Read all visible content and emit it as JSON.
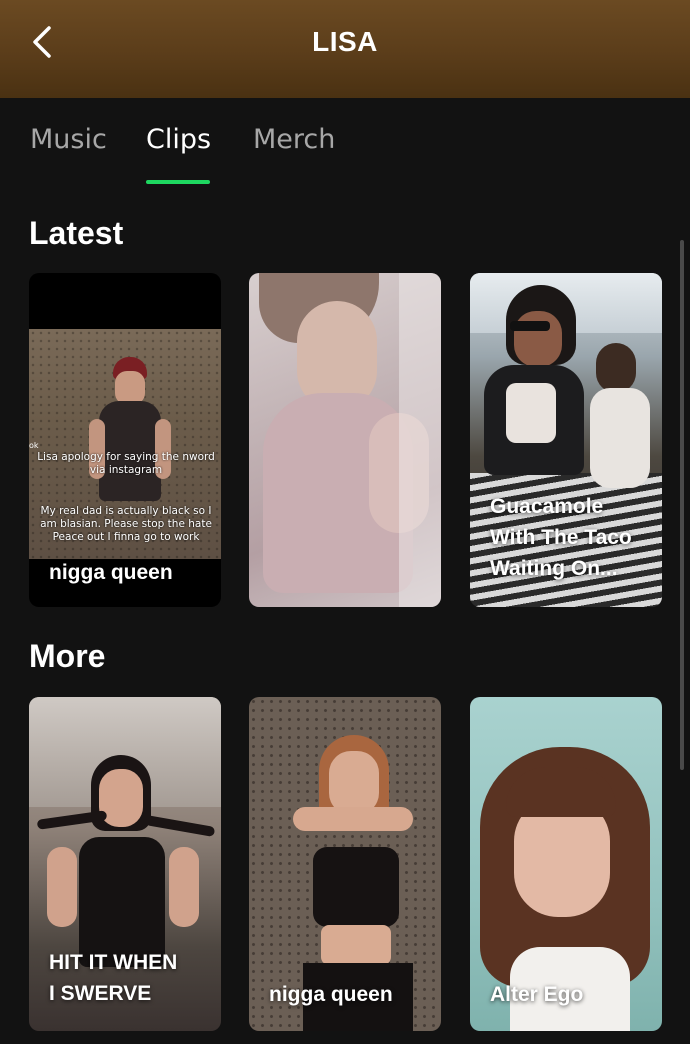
{
  "header": {
    "title": "LISA"
  },
  "tabs": [
    {
      "label": "Music",
      "active": false
    },
    {
      "label": "Clips",
      "active": true
    },
    {
      "label": "Merch",
      "active": false
    }
  ],
  "accent_color": "#1ed760",
  "sections": {
    "latest": {
      "title": "Latest",
      "clips": [
        {
          "label": "nigga queen",
          "overlay_text": {
            "caption1": "Lisa apology for saying the nword via instagram",
            "caption2": "My real dad is actually black so I am blasian. Please stop the hate Peace out I finna go to work",
            "corner": "ok"
          }
        },
        {
          "label": ""
        },
        {
          "label": "Guacamole\nWith The Taco\nWaiting On..."
        }
      ]
    },
    "more": {
      "title": "More",
      "clips": [
        {
          "label": "HIT IT WHEN\nI SWERVE"
        },
        {
          "label": "nigga queen"
        },
        {
          "label": "Alter Ego"
        }
      ]
    }
  }
}
